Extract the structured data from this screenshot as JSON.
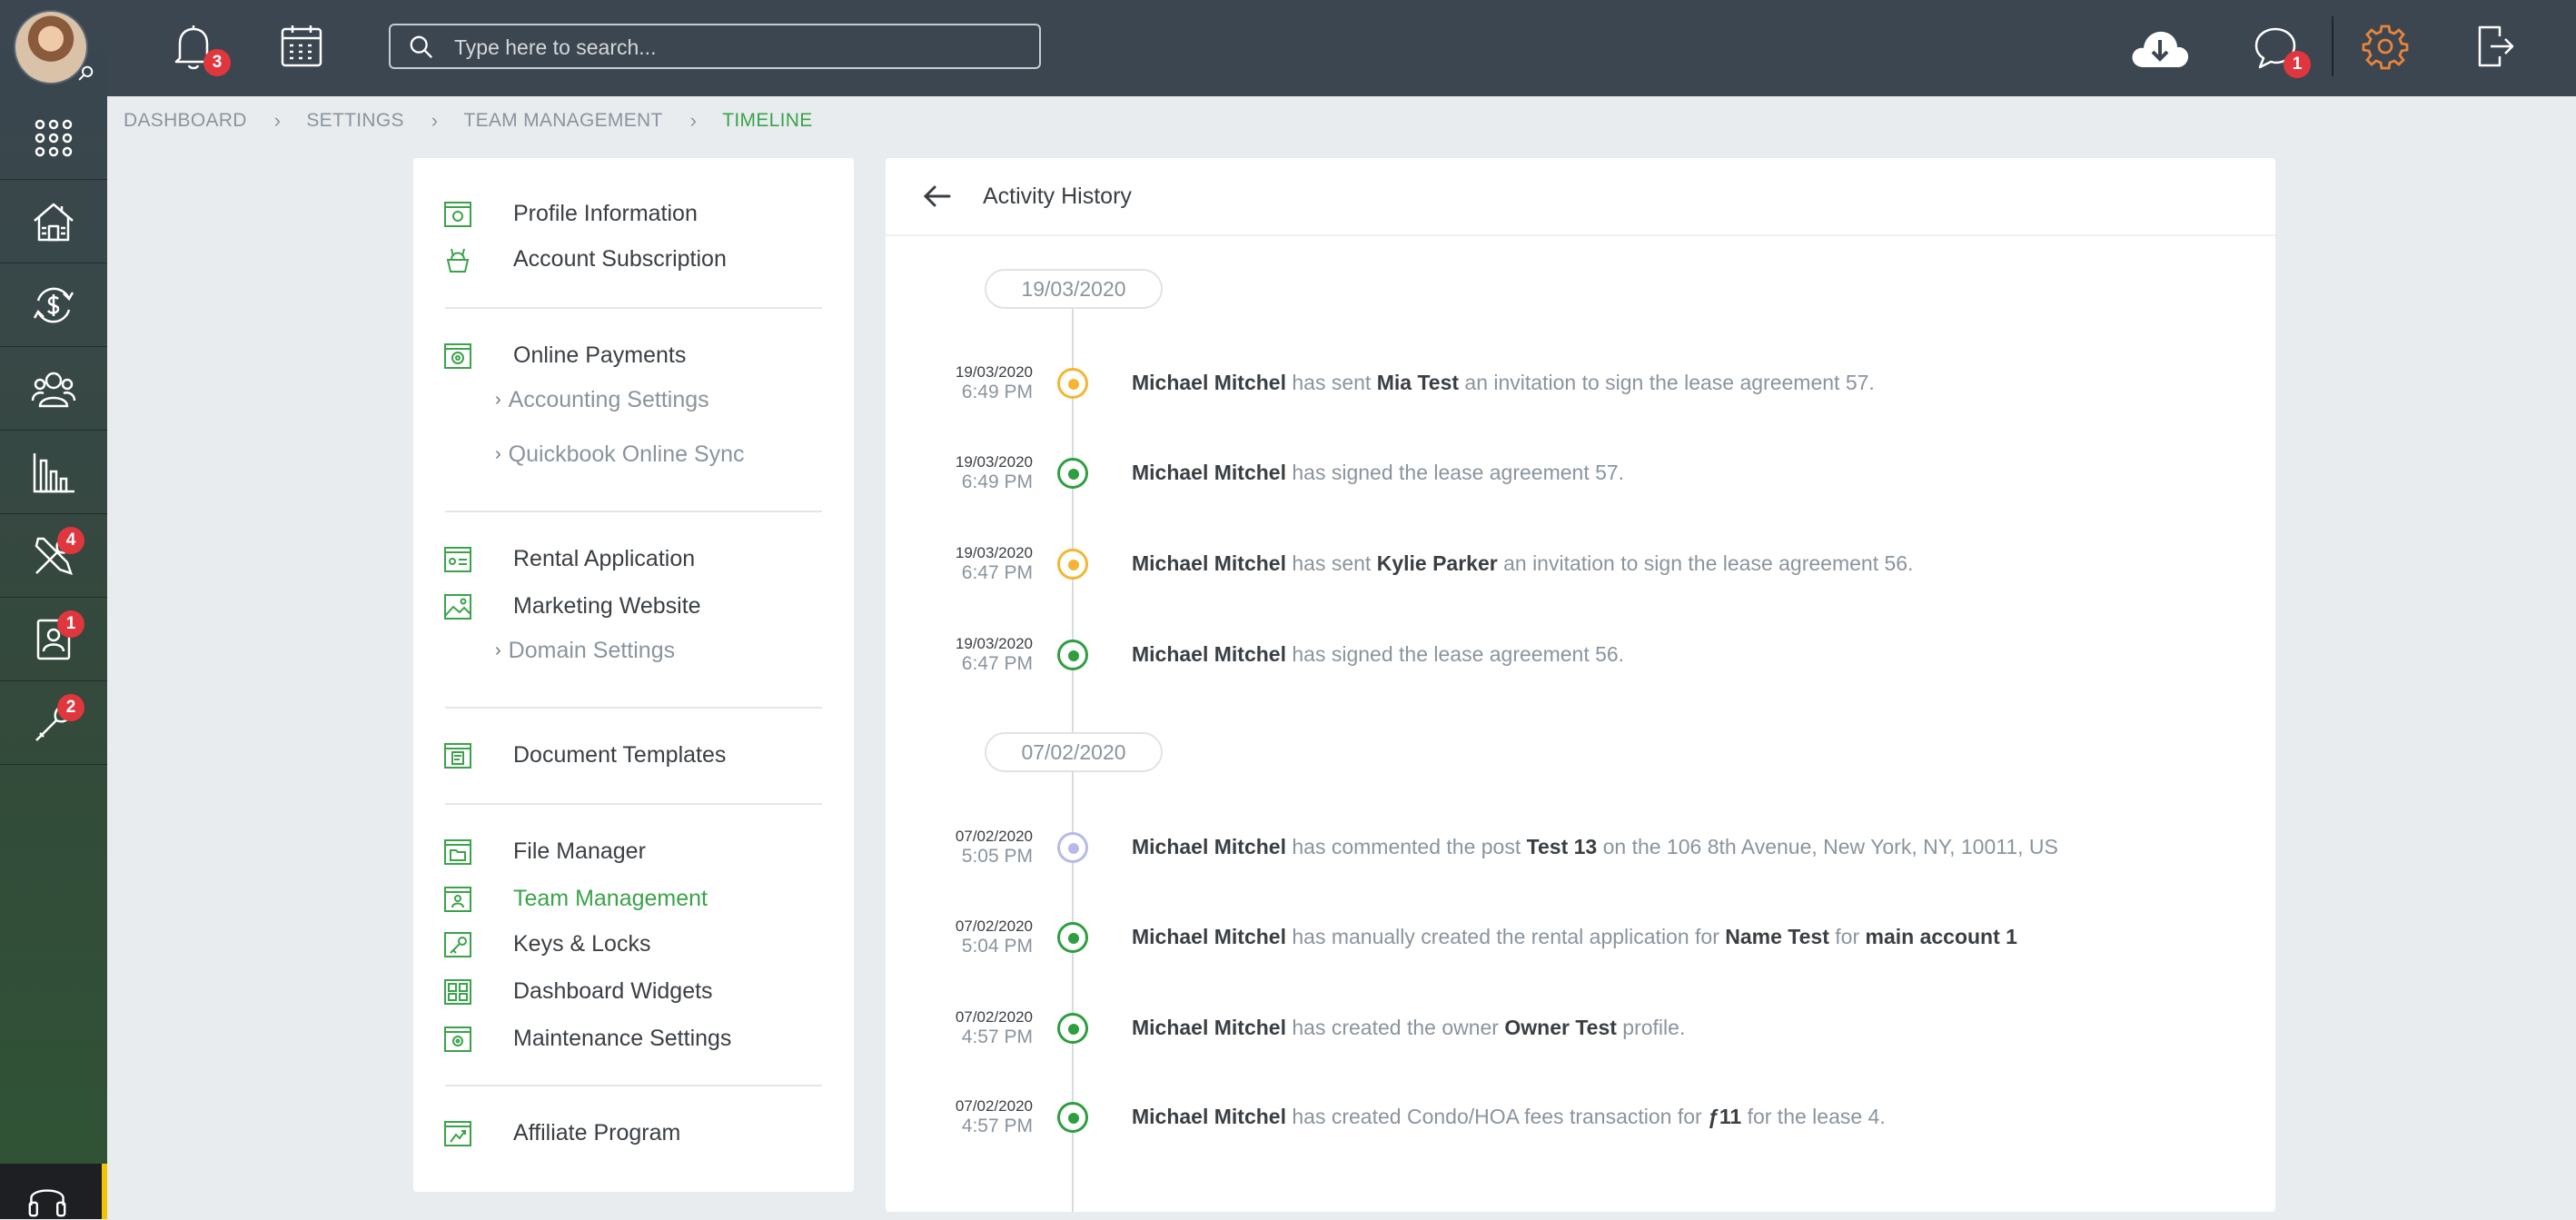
{
  "sidebar": {
    "badges": {
      "tools": "4",
      "tenant": "1",
      "maintenance": "2"
    }
  },
  "topbar": {
    "notifications_count": "3",
    "messages_count": "1",
    "search_placeholder": "Type here to search..."
  },
  "breadcrumb": [
    "DASHBOARD",
    "SETTINGS",
    "TEAM MANAGEMENT",
    "TIMELINE"
  ],
  "settings_menu": {
    "profile_information": "Profile Information",
    "account_subscription": "Account Subscription",
    "online_payments": "Online Payments",
    "accounting_settings": "Accounting Settings",
    "quickbook_online_sync": "Quickbook Online Sync",
    "rental_application": "Rental Application",
    "marketing_website": "Marketing Website",
    "domain_settings": "Domain Settings",
    "document_templates": "Document Templates",
    "file_manager": "File Manager",
    "team_management": "Team Management",
    "keys_locks": "Keys & Locks",
    "dashboard_widgets": "Dashboard Widgets",
    "maintenance_settings": "Maintenance Settings",
    "affiliate_program": "Affiliate Program"
  },
  "activity": {
    "title": "Activity History",
    "groups": [
      {
        "date": "19/03/2020",
        "entries": [
          {
            "date": "19/03/2020",
            "time": "6:49 PM",
            "status_color": "#f2b632",
            "parts": [
              "Michael Mitchel",
              " has sent ",
              "Mia Test",
              " an invitation to sign the lease agreement 57."
            ]
          },
          {
            "date": "19/03/2020",
            "time": "6:49 PM",
            "status_color": "#2e9e3f",
            "parts": [
              "Michael Mitchel",
              " has signed the lease agreement 57."
            ]
          },
          {
            "date": "19/03/2020",
            "time": "6:47 PM",
            "status_color": "#f2b632",
            "parts": [
              "Michael Mitchel",
              " has sent ",
              "Kylie Parker",
              " an invitation to sign the lease agreement 56."
            ]
          },
          {
            "date": "19/03/2020",
            "time": "6:47 PM",
            "status_color": "#2e9e3f",
            "parts": [
              "Michael Mitchel",
              " has signed the lease agreement 56."
            ]
          }
        ]
      },
      {
        "date": "07/02/2020",
        "entries": [
          {
            "date": "07/02/2020",
            "time": "5:05 PM",
            "status_color": "#b7b9ea",
            "parts": [
              "Michael Mitchel",
              " has commented the post ",
              "Test 13",
              " on the 106 8th Avenue, New York, NY, 10011, US"
            ]
          },
          {
            "date": "07/02/2020",
            "time": "5:04 PM",
            "status_color": "#2e9e3f",
            "parts": [
              "Michael Mitchel",
              " has manually created the rental application for ",
              "Name Test",
              " for ",
              "main account 1"
            ]
          },
          {
            "date": "07/02/2020",
            "time": "4:57 PM",
            "status_color": "#2e9e3f",
            "parts": [
              "Michael Mitchel",
              " has created the owner ",
              "Owner Test",
              " profile."
            ]
          },
          {
            "date": "07/02/2020",
            "time": "4:57 PM",
            "status_color": "#2e9e3f",
            "parts": [
              "Michael Mitchel",
              " has created Condo/HOA fees transaction for ",
              "ƒ11",
              " for the lease 4."
            ]
          }
        ]
      }
    ]
  },
  "colors": {
    "accent_green": "#3aa34a",
    "pending_yellow": "#f2b632",
    "comment_lavender": "#b7b9ea",
    "settings_orange": "#e8843a",
    "badge_red": "#e0363d"
  }
}
